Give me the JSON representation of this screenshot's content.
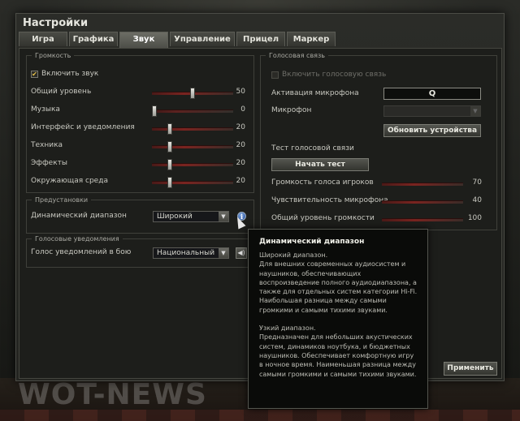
{
  "window": {
    "title": "Настройки"
  },
  "tabs": [
    {
      "label": "Игра",
      "active": false
    },
    {
      "label": "Графика",
      "active": false
    },
    {
      "label": "Звук",
      "active": true
    },
    {
      "label": "Управление",
      "active": false
    },
    {
      "label": "Прицел",
      "active": false
    },
    {
      "label": "Маркер",
      "active": false
    }
  ],
  "volume": {
    "legend": "Громкость",
    "enable_sound": {
      "label": "Включить звук",
      "checked": true
    },
    "sliders": [
      {
        "label": "Общий уровень",
        "value": "50",
        "fraction": 0.5
      },
      {
        "label": "Музыка",
        "value": "0",
        "fraction": 0.0
      },
      {
        "label": "Интерфейс и уведомления",
        "value": "20",
        "fraction": 0.2
      },
      {
        "label": "Техника",
        "value": "20",
        "fraction": 0.2
      },
      {
        "label": "Эффекты",
        "value": "20",
        "fraction": 0.2
      },
      {
        "label": "Окружающая среда",
        "value": "20",
        "fraction": 0.2
      }
    ]
  },
  "presets": {
    "legend": "Предустановки",
    "dynamic_range_label": "Динамический диапазон",
    "dynamic_range_value": "Широкий",
    "info_icon": "info-icon"
  },
  "notifications": {
    "legend": "Голосовые уведомления",
    "voice_label": "Голос уведомлений в бою",
    "voice_value": "Национальный",
    "speaker_icon": "speaker-icon"
  },
  "voice_chat": {
    "legend": "Голосовая связь",
    "enable_voice": {
      "label": "Включить голосовую связь",
      "checked": false
    },
    "mic_activation_label": "Активация микрофона",
    "mic_activation_key": "Q",
    "mic_label": "Микрофон",
    "mic_value": "",
    "refresh_button": "Обновить устройства",
    "test_label": "Тест голосовой связи",
    "test_button": "Начать тест",
    "sliders": [
      {
        "label": "Громкость голоса игроков",
        "value": "70",
        "fraction": 0.7
      },
      {
        "label": "Чувствительность микрофона",
        "value": "40",
        "fraction": 0.4
      },
      {
        "label": "Общий уровень громкости",
        "value": "100",
        "fraction": 1.0
      }
    ]
  },
  "tooltip": {
    "title": "Динамический диапазон",
    "paragraphs": [
      "Широкий диапазон.\nДля внешних современных аудиосистем и наушников, обеспечивающих воспроизведение полного аудиодиапазона, а также для отдельных систем категории Hi-Fi. Наибольшая разница между самыми громкими и самыми тихими звуками.",
      "Узкий диапазон.\nПредназначен для небольших акустических систем, динамиков ноутбука, и бюджетных наушников. Обеспечивает комфортную игру в ночное время. Наименьшая разница между самыми громкими и самыми тихими звуками."
    ]
  },
  "footer": {
    "apply_button": "Применить"
  },
  "watermark": "WOT-NEWS",
  "colors": {
    "accent": "#7a2420",
    "panel": "#1d1e1b",
    "text": "#c8c8c0"
  }
}
